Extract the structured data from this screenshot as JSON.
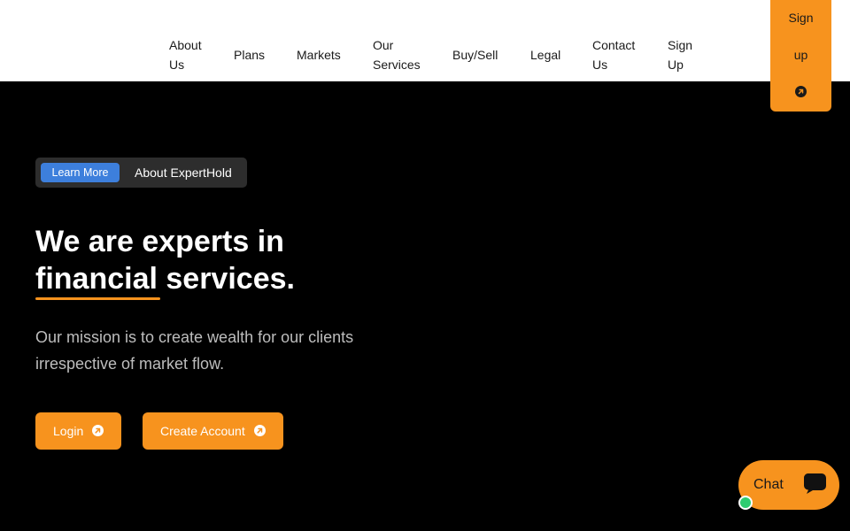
{
  "nav": {
    "items": [
      {
        "label": "About Us"
      },
      {
        "label": "Plans"
      },
      {
        "label": "Markets"
      },
      {
        "label": "Our Services"
      },
      {
        "label": "Buy/Sell"
      },
      {
        "label": "Legal"
      },
      {
        "label": "Contact Us"
      },
      {
        "label": "Sign Up"
      }
    ],
    "signup_line1": "Sign",
    "signup_line2": "up"
  },
  "badge": {
    "pill": "Learn More",
    "text": "About ExpertHold"
  },
  "hero": {
    "title_part1": "We are experts in",
    "title_underlined": "financial",
    "title_part2": " services.",
    "subtitle": "Our mission is to create wealth for our clients irrespective of market flow."
  },
  "actions": {
    "login": "Login",
    "create_account": "Create Account"
  },
  "chat": {
    "label": "Chat"
  },
  "colors": {
    "accent": "#f7931e",
    "badge_pill": "#3d7fdc",
    "online": "#2ecc71",
    "background": "#000000"
  },
  "icons": {
    "arrow": "arrow-up-right-circle-icon",
    "chat": "speech-bubble-icon"
  }
}
